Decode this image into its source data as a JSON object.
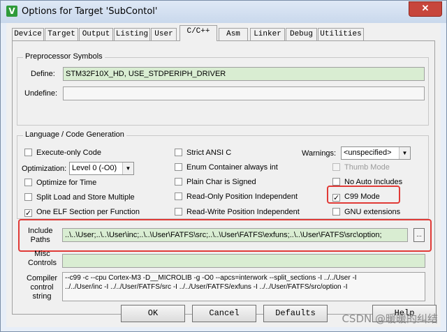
{
  "window": {
    "title": "Options for Target 'SubContol'",
    "close_glyph": "✕",
    "app_icon_glyph": "V"
  },
  "tabs": [
    "Device",
    "Target",
    "Output",
    "Listing",
    "User",
    "C/C++",
    "Asm",
    "Linker",
    "Debug",
    "Utilities"
  ],
  "active_tab": "C/C++",
  "preprocessor": {
    "group_title": "Preprocessor Symbols",
    "define_label": "Define:",
    "define_value": "STM32F10X_HD, USE_STDPERIPH_DRIVER",
    "undefine_label": "Undefine:",
    "undefine_value": ""
  },
  "language": {
    "group_title": "Language / Code Generation",
    "execute_only": {
      "label": "Execute-only Code",
      "checked": false
    },
    "optimization_label": "Optimization:",
    "optimization_value": "Level 0 (-O0)",
    "optimize_time": {
      "label": "Optimize for Time",
      "checked": false
    },
    "split_load": {
      "label": "Split Load and Store Multiple",
      "checked": false
    },
    "one_elf": {
      "label": "One ELF Section per Function",
      "checked": true
    },
    "strict_ansi": {
      "label": "Strict ANSI C",
      "checked": false
    },
    "enum_container": {
      "label": "Enum Container always int",
      "checked": false
    },
    "plain_char": {
      "label": "Plain Char is Signed",
      "checked": false
    },
    "ro_pos": {
      "label": "Read-Only Position Independent",
      "checked": false
    },
    "rw_pos": {
      "label": "Read-Write Position Independent",
      "checked": false
    },
    "warnings_label": "Warnings:",
    "warnings_value": "<unspecified>",
    "thumb_mode": {
      "label": "Thumb Mode",
      "checked": false
    },
    "no_auto_includes": {
      "label": "No Auto Includes",
      "checked": false
    },
    "c99_mode": {
      "label": "C99 Mode",
      "checked": true
    },
    "gnu_ext": {
      "label": "GNU extensions",
      "checked": false
    }
  },
  "include": {
    "label_line1": "Include",
    "label_line2": "Paths",
    "value": "..\\..\\User;..\\..\\User\\inc;..\\..\\User\\FATFS\\src;..\\..\\User\\FATFS\\exfuns;..\\..\\User\\FATFS\\src\\option;",
    "browse_glyph": "..."
  },
  "misc": {
    "label_line1": "Misc",
    "label_line2": "Controls",
    "value": ""
  },
  "compiler": {
    "label_line1": "Compiler",
    "label_line2": "control",
    "label_line3": "string",
    "line1": "--c99 -c --cpu Cortex-M3 -D__MICROLIB -g -O0 --apcs=interwork --split_sections -I ../../User -I",
    "line2": "../../User/inc -I ../../User/FATFS/src -I ../../User/FATFS/exfuns -I ../../User/FATFS/src/option -I"
  },
  "buttons": {
    "ok": "OK",
    "cancel": "Cancel",
    "defaults": "Defaults",
    "help": "Help"
  },
  "watermark": "CSDN @暖暖的纠结",
  "highlight_color": "#e03a36"
}
